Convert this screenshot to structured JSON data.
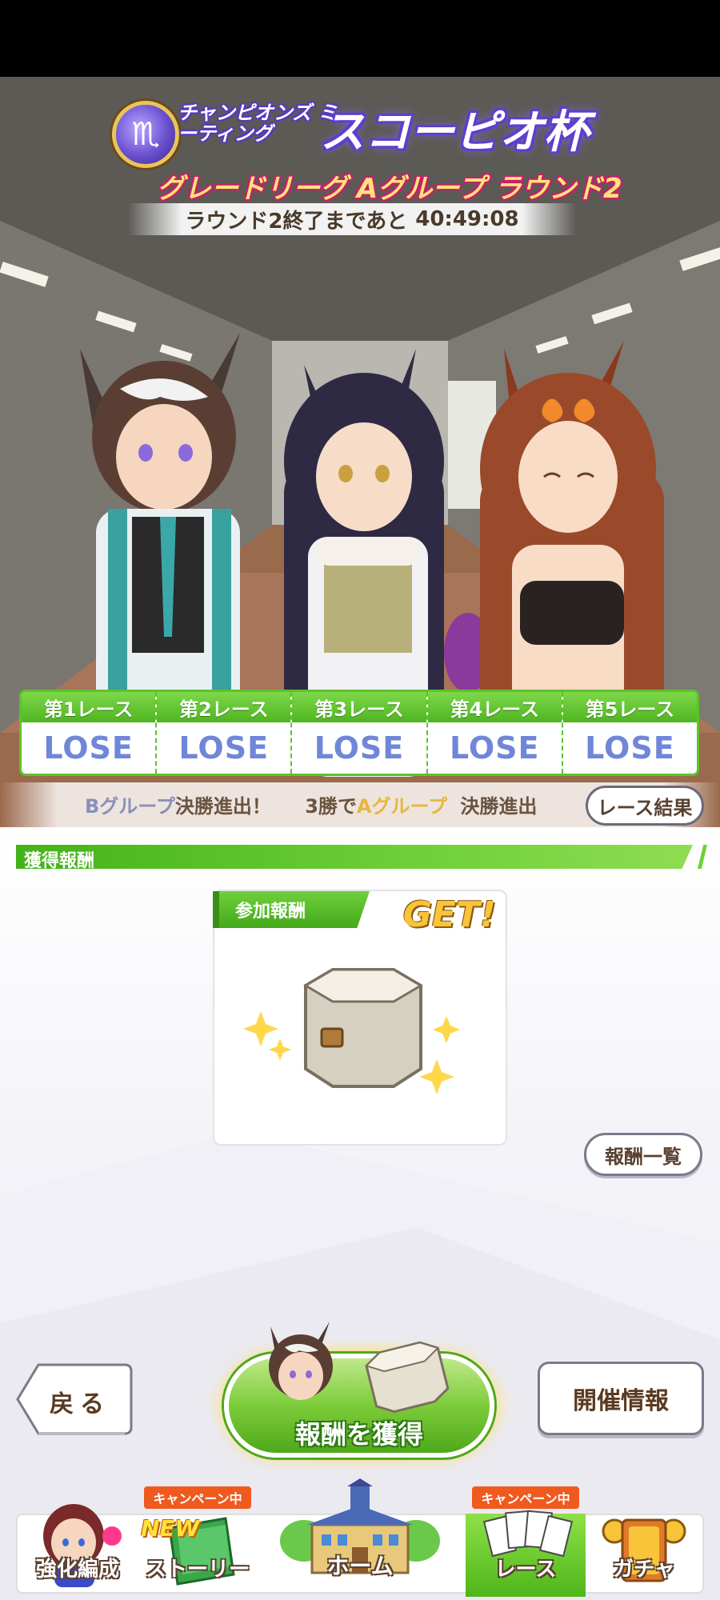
{
  "event": {
    "subtitle": "チャンピオンズ ミーティング",
    "name": "スコーピオ杯",
    "league": "グレードリーグ Aグループ ラウンド2",
    "countdown_prefix": "ラウンド2終了まであと",
    "countdown": "40:49:08"
  },
  "races": [
    {
      "label": "第1レース",
      "result": "LOSE"
    },
    {
      "label": "第2レース",
      "result": "LOSE"
    },
    {
      "label": "第3レース",
      "result": "LOSE"
    },
    {
      "label": "第4レース",
      "result": "LOSE"
    },
    {
      "label": "第5レース",
      "result": "LOSE"
    }
  ],
  "notice": {
    "group_b": "Bグループ",
    "text1": "決勝進出！",
    "text2": "3勝で",
    "group_a": "Aグループ",
    "text3": "決勝進出"
  },
  "results_button": "レース結果",
  "rewards": {
    "header": "獲得報酬",
    "card_tag": "参加報酬",
    "get_label": "GET!",
    "list_button": "報酬一覧"
  },
  "actions": {
    "back": "戻る",
    "info": "開催情報",
    "claim": "報酬を獲得"
  },
  "nav": {
    "items": [
      {
        "label": "強化編成"
      },
      {
        "label": "ストーリー",
        "badge": "キャンペーン中",
        "new": "NEW"
      },
      {
        "label": "ホーム"
      },
      {
        "label": "レース",
        "badge": "キャンペーン中"
      },
      {
        "label": "ガチャ"
      }
    ]
  },
  "colors": {
    "accent_green": "#5cc32a",
    "lose_blue": "#6f86d9",
    "brown_text": "#5a3a20",
    "campaign_orange": "#f05a1e"
  }
}
